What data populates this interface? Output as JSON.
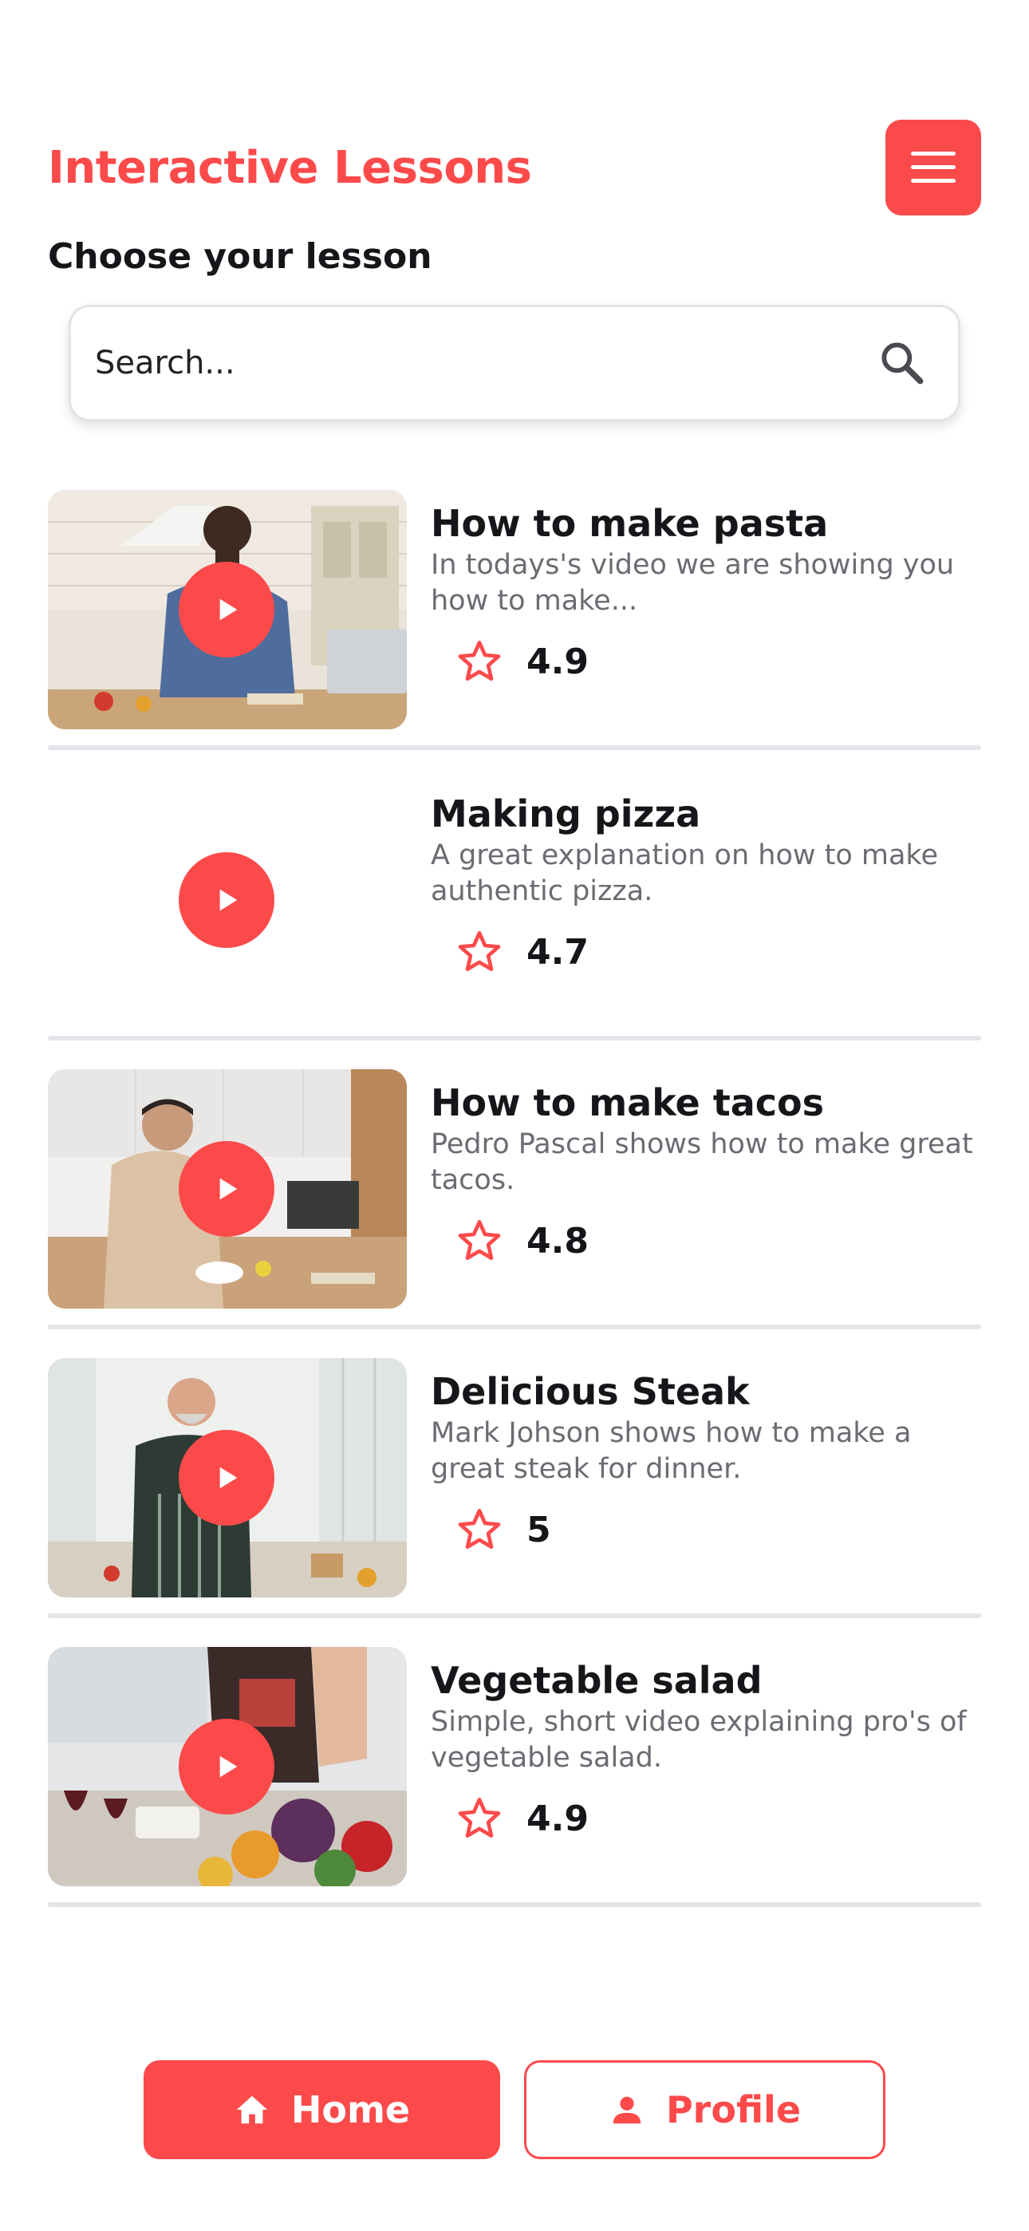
{
  "app": {
    "title": "Interactive Lessons"
  },
  "section": {
    "title": "Choose your lesson"
  },
  "search": {
    "placeholder": "Search..."
  },
  "colors": {
    "accent": "#fc4a4b",
    "text": "#16161a",
    "muted": "#6b6b73",
    "divider": "#e4e4ea"
  },
  "icons": {
    "menu": "hamburger-menu-icon",
    "search": "search-icon",
    "play": "play-icon",
    "star": "star-outline-icon",
    "home": "home-icon",
    "profile": "person-icon"
  },
  "lessons": [
    {
      "title": "How to make pasta",
      "description": "In todays's video we are showing you how to make...",
      "rating": "4.9"
    },
    {
      "title": "Making pizza",
      "description": "A great explanation on how to make authentic pizza.",
      "rating": "4.7"
    },
    {
      "title": "How to make tacos",
      "description": "Pedro Pascal shows how to make great tacos.",
      "rating": "4.8"
    },
    {
      "title": "Delicious Steak",
      "description": "Mark Johson shows how to make a great steak for dinner.",
      "rating": "5"
    },
    {
      "title": "Vegetable salad",
      "description": "Simple, short video explaining pro's of vegetable salad.",
      "rating": "4.9"
    }
  ],
  "nav": {
    "home_label": "Home",
    "profile_label": "Profile"
  }
}
